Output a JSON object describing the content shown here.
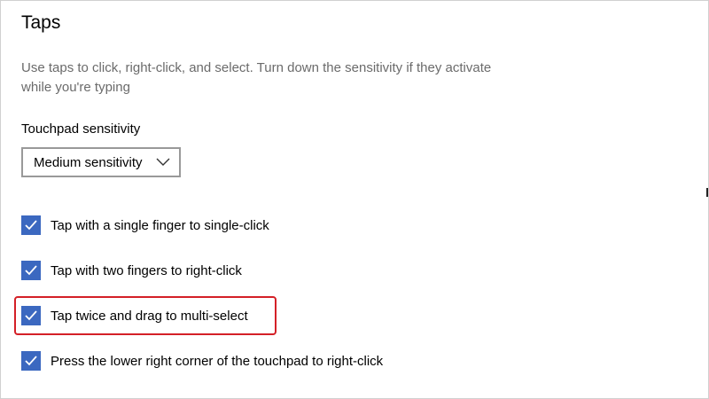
{
  "section": {
    "title": "Taps",
    "description": "Use taps to click, right-click, and select. Turn down the sensitivity if they activate while you're typing"
  },
  "sensitivity": {
    "label": "Touchpad sensitivity",
    "selected": "Medium sensitivity"
  },
  "options": [
    {
      "label": "Tap with a single finger to single-click",
      "checked": true
    },
    {
      "label": "Tap with two fingers to right-click",
      "checked": true
    },
    {
      "label": "Tap twice and drag to multi-select",
      "checked": true,
      "highlighted": true
    },
    {
      "label": "Press the lower right corner of the touchpad to right-click",
      "checked": true
    }
  ],
  "colors": {
    "checkbox_fill": "#3b68c0",
    "highlight_border": "#d42027",
    "description_text": "#6b6b6b"
  },
  "icons": {
    "dropdown": "chevron-down-icon",
    "checkbox": "checkmark-icon"
  }
}
